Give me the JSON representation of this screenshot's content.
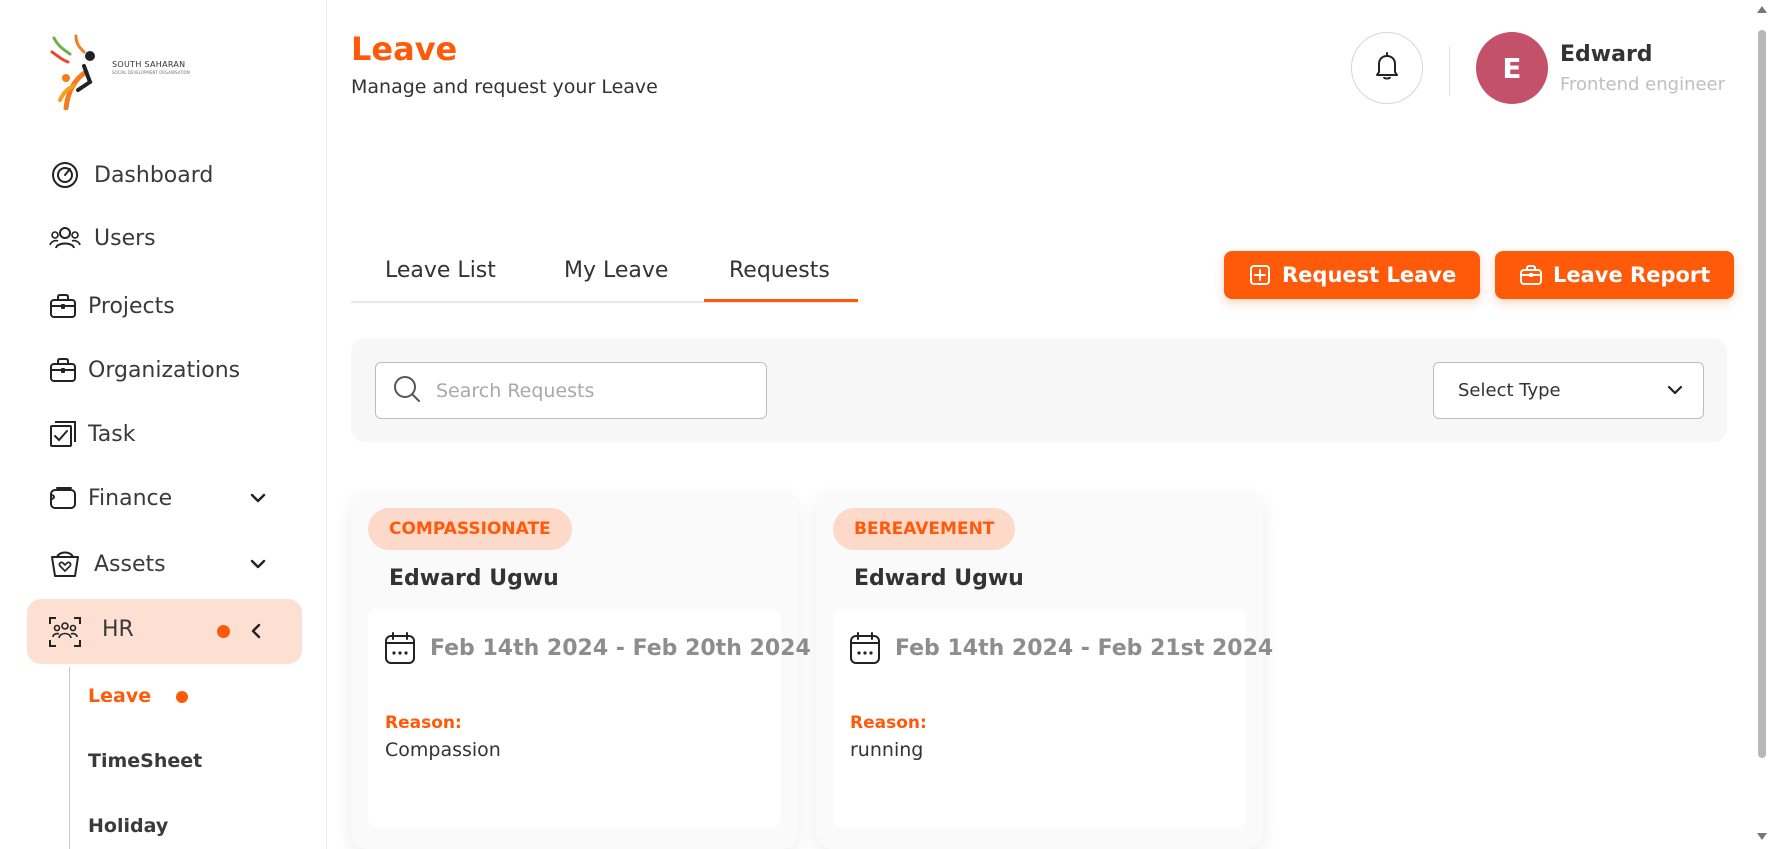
{
  "app": {
    "logo_text": "SOUTH SAHARAN",
    "logo_subtext": "SOCIAL DEVELOPMENT ORGANISATION"
  },
  "sidebar": {
    "items": [
      {
        "label": "Dashboard",
        "icon": "dashboard-icon"
      },
      {
        "label": "Users",
        "icon": "users-icon"
      },
      {
        "label": "Projects",
        "icon": "briefcase-icon"
      },
      {
        "label": "Organizations",
        "icon": "briefcase-icon"
      },
      {
        "label": "Task",
        "icon": "task-check-icon"
      },
      {
        "label": "Finance",
        "icon": "wallet-icon"
      },
      {
        "label": "Assets",
        "icon": "assets-icon"
      },
      {
        "label": "HR",
        "icon": "team-icon"
      }
    ],
    "hr_submenu": [
      {
        "label": "Leave",
        "active": true
      },
      {
        "label": "TimeSheet",
        "active": false
      },
      {
        "label": "Holiday",
        "active": false
      }
    ]
  },
  "header": {
    "title": "Leave",
    "subtitle": "Manage and request your Leave",
    "user": {
      "initial": "E",
      "name": "Edward",
      "role": "Frontend engineer",
      "avatar_color": "#c4516a"
    }
  },
  "tabs": [
    {
      "label": "Leave List",
      "active": false
    },
    {
      "label": "My Leave",
      "active": false
    },
    {
      "label": "Requests",
      "active": true
    }
  ],
  "actions": {
    "request_leave": "Request Leave",
    "leave_report": "Leave Report"
  },
  "filters": {
    "search_placeholder": "Search Requests",
    "select_type": "Select Type"
  },
  "requests": [
    {
      "type": "COMPASSIONATE",
      "name": "Edward Ugwu",
      "dates": "Feb 14th 2024 - Feb 20th 2024",
      "reason_label": "Reason:",
      "reason": "Compassion"
    },
    {
      "type": "BEREAVEMENT",
      "name": "Edward Ugwu",
      "dates": "Feb 14th 2024 - Feb 21st 2024",
      "reason_label": "Reason:",
      "reason": "running"
    }
  ],
  "colors": {
    "accent": "#ff5a0a",
    "active_nav_bg": "#fde0d2",
    "badge_bg": "#fcd9c8"
  }
}
